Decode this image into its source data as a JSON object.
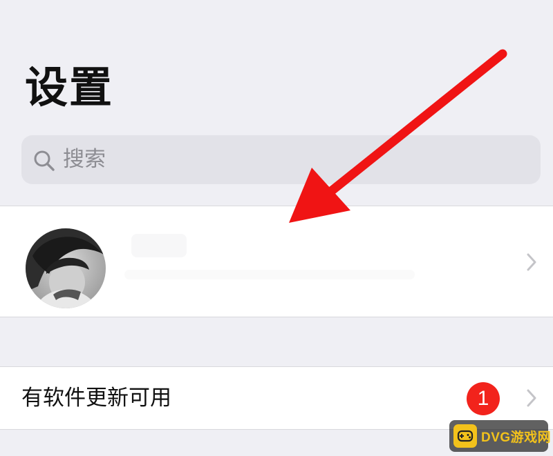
{
  "header": {
    "title": "设置"
  },
  "search": {
    "placeholder": "搜索",
    "icon": "search-icon"
  },
  "profile": {
    "avatar": "avatar",
    "chevron": "chevron-right-icon"
  },
  "updates": {
    "label": "有软件更新可用",
    "badge_count": "1",
    "chevron": "chevron-right-icon"
  },
  "annotation": {
    "arrow_color": "#f01414"
  },
  "watermark": {
    "text": "DVG游戏网"
  },
  "colors": {
    "background": "#efeff4",
    "group_background": "#ffffff",
    "search_background": "#e2e2e8",
    "badge": "#f2231c",
    "watermark_accent": "#f3c21b"
  }
}
